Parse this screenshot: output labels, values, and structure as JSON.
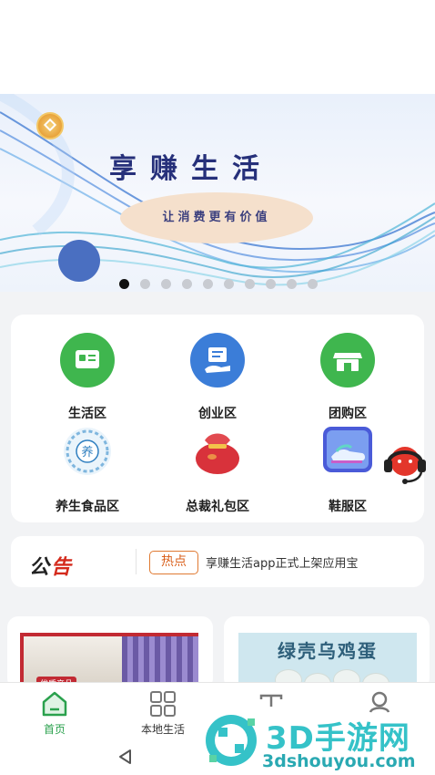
{
  "banner": {
    "title": "享赚生活",
    "subtitle": "让消费更有价值",
    "pages": 10,
    "active_page": 0
  },
  "categories": [
    {
      "label": "生活区",
      "icon": "life-icon"
    },
    {
      "label": "创业区",
      "icon": "startup-icon"
    },
    {
      "label": "团购区",
      "icon": "groupbuy-store-icon"
    },
    {
      "label": "养生食品区",
      "icon": "health-food-icon"
    },
    {
      "label": "总裁礼包区",
      "icon": "gift-bag-icon"
    },
    {
      "label": "鞋服区",
      "icon": "shoes-icon"
    }
  ],
  "notice": {
    "logo_a": "公",
    "logo_b": "告",
    "tag": "热点",
    "text": "享赚生活app正式上架应用宝"
  },
  "products": {
    "left_badge": "优质产品",
    "right_title": "绿壳乌鸡蛋"
  },
  "tabbar": [
    {
      "label": "首页",
      "icon": "home-icon",
      "active": true
    },
    {
      "label": "本地生活",
      "icon": "grid-icon",
      "active": false
    },
    {
      "label": "",
      "icon": "order-icon",
      "active": false
    },
    {
      "label": "",
      "icon": "profile-icon",
      "active": false
    }
  ],
  "watermark": {
    "text": "3D手游网",
    "url": "3dshouyou.com"
  },
  "colors": {
    "accent_green": "#3fb64e",
    "accent_blue": "#3b7dd8",
    "notice_red": "#d42a1c",
    "tag_orange": "#e07a32"
  }
}
